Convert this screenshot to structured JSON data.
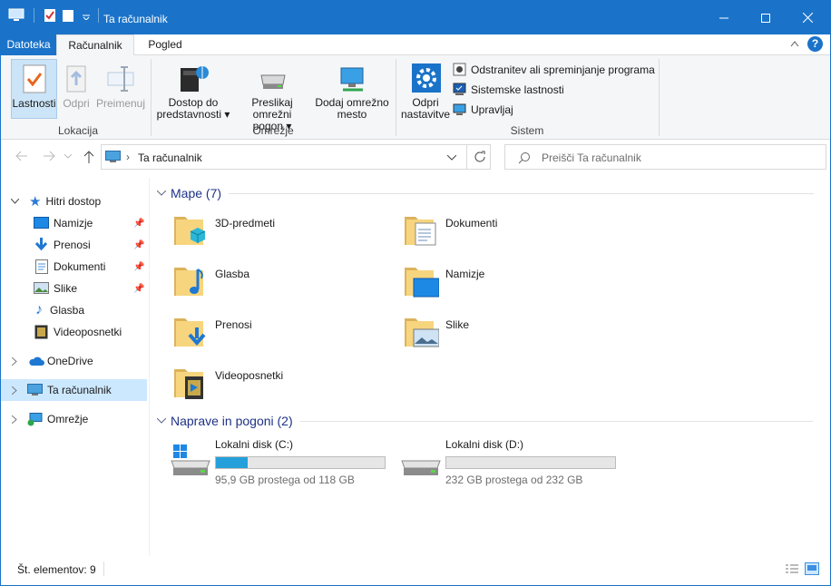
{
  "window": {
    "title": "Ta računalnik"
  },
  "tabs": {
    "file": "Datoteka",
    "computer": "Računalnik",
    "view": "Pogled"
  },
  "ribbon": {
    "properties": "Lastnosti",
    "open": "Odpri",
    "rename": "Preimenuj",
    "group_location": "Lokacija",
    "media_access_1": "Dostop do",
    "media_access_2": "predstavnosti",
    "map_drive_1": "Preslikaj omrežni",
    "map_drive_2": "pogon",
    "add_location_1": "Dodaj omrežno",
    "add_location_2": "mesto",
    "group_network": "Omrežje",
    "open_settings_1": "Odpri",
    "open_settings_2": "nastavitve",
    "uninstall": "Odstranitev ali spreminjanje programa",
    "system_properties": "Sistemske lastnosti",
    "manage": "Upravljaj",
    "group_system": "Sistem"
  },
  "address": {
    "path": "Ta računalnik",
    "search_placeholder": "Preišči Ta računalnik"
  },
  "nav": {
    "quick_access": "Hitri dostop",
    "desktop": "Namizje",
    "downloads": "Prenosi",
    "documents": "Dokumenti",
    "pictures": "Slike",
    "music": "Glasba",
    "videos": "Videoposnetki",
    "onedrive": "OneDrive",
    "this_pc": "Ta računalnik",
    "network": "Omrežje"
  },
  "folders_group": "Mape (7)",
  "folders": [
    "3D-predmeti",
    "Dokumenti",
    "Glasba",
    "Namizje",
    "Prenosi",
    "Slike",
    "Videoposnetki"
  ],
  "drives_group": "Naprave in pogoni (2)",
  "drives": [
    {
      "name": "Lokalni disk (C:)",
      "info": "95,9 GB prostega od 118 GB",
      "used_fraction": 0.19
    },
    {
      "name": "Lokalni disk (D:)",
      "info": "232 GB prostega od 232 GB",
      "used_fraction": 0.0
    }
  ],
  "status": {
    "count": "Št. elementov: 9"
  },
  "colors": {
    "accent": "#1a73c9",
    "selection": "#cce8ff",
    "bar_fill": "#26a0da"
  }
}
